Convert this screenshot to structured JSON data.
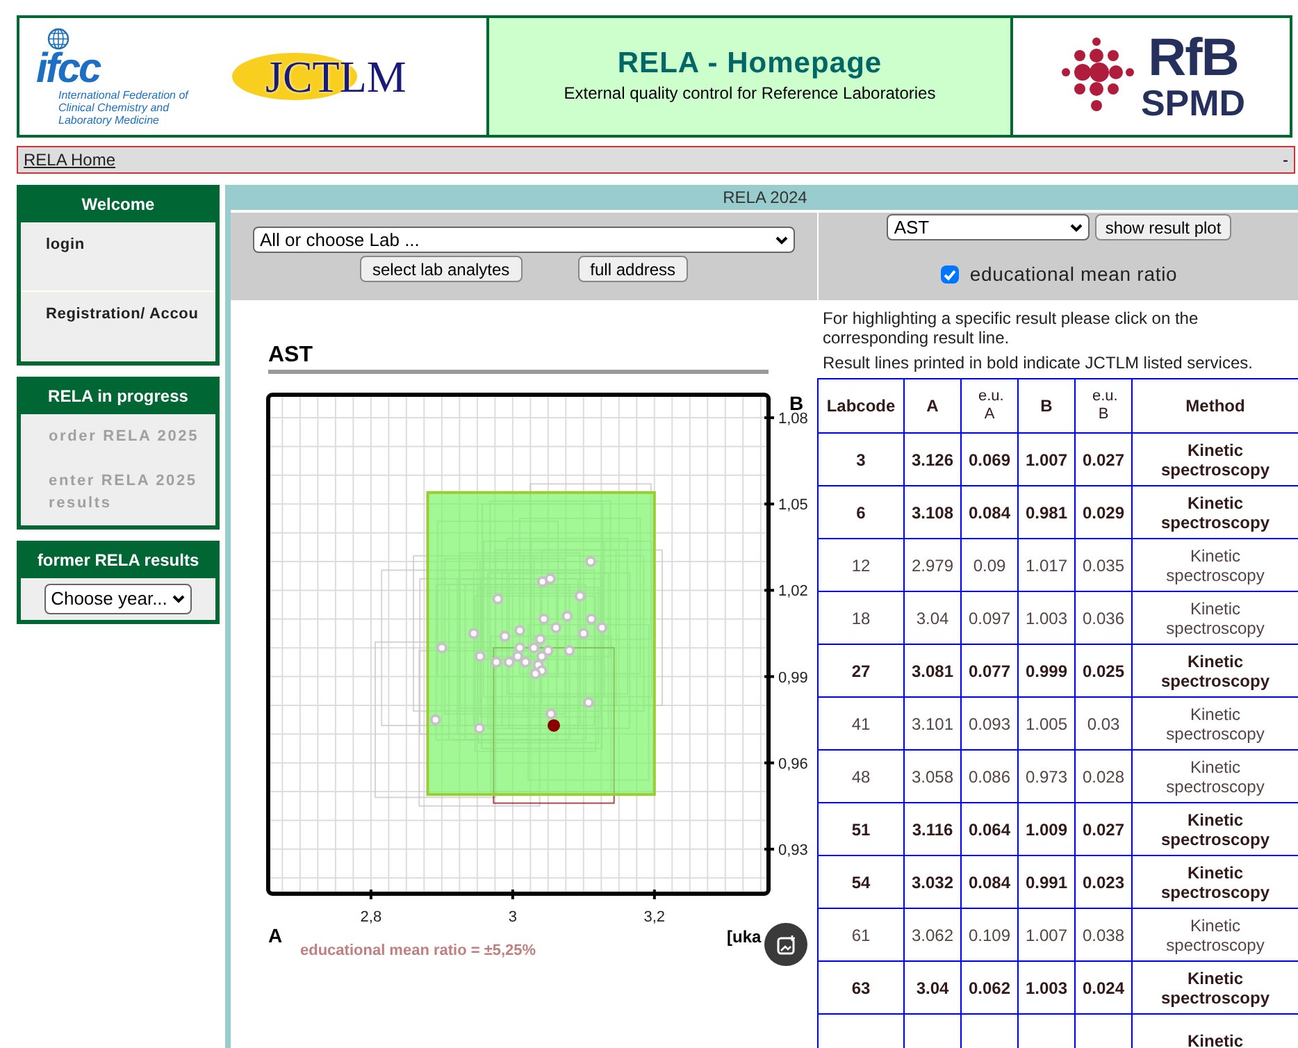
{
  "header": {
    "ifcc_logo": {
      "mark": "ifcc",
      "caption": "International Federation of Clinical Chemistry and Laboratory Medicine"
    },
    "jctlm_logo": "JCTLM",
    "title": "RELA - Homepage",
    "subtitle": "External quality control for Reference Laboratories",
    "rfb_logo": {
      "line1": "RfB",
      "line2": "SPMD"
    }
  },
  "breadcrumb": {
    "link": "RELA Home",
    "marker": "-"
  },
  "sidebar": [
    {
      "title": "Welcome",
      "items": [
        {
          "label": "login",
          "disabled": false
        },
        {
          "label": "Registration/ Accou",
          "disabled": false
        }
      ]
    },
    {
      "title": "RELA in progress",
      "items": [
        {
          "label": "order RELA 2025",
          "disabled": true
        },
        {
          "label": "enter RELA 2025 results",
          "disabled": true
        }
      ]
    },
    {
      "title": "former RELA results",
      "select": "Choose year..."
    }
  ],
  "main": {
    "title": "RELA 2024",
    "lab_select": "All or choose Lab ...",
    "buttons": [
      "select lab analytes",
      "full address"
    ],
    "analyte_select": "AST",
    "plot_button": "show result plot",
    "edu_checkbox": {
      "label": "educational mean ratio",
      "checked": true
    },
    "chart_title": "AST",
    "chart_data": {
      "type": "scatter",
      "grid": true,
      "xlabel": "A",
      "ylabel": "B",
      "xlim": [
        2.655,
        3.361
      ],
      "ylim": [
        0.9145,
        1.088
      ],
      "xticks": [
        {
          "value": 2.8,
          "label": "2,8"
        },
        {
          "value": 3,
          "label": "3"
        },
        {
          "value": 3.2,
          "label": "3,2"
        }
      ],
      "yticks": [
        {
          "value": 1.08,
          "label": "1,08"
        },
        {
          "value": 1.05,
          "label": "1,05"
        },
        {
          "value": 1.02,
          "label": "1,02"
        },
        {
          "value": 0.99,
          "label": "0,99"
        },
        {
          "value": 0.96,
          "label": "0,96"
        },
        {
          "value": 0.93,
          "label": "0,93"
        }
      ],
      "series": [
        {
          "color": "#c8c0c8",
          "x": [
            3.11,
            3.042,
            3.053,
            2.979,
            3.095,
            3.044,
            3.077,
            3.111,
            3.061,
            3.126,
            3.01,
            2.945,
            2.989,
            3.039,
            3.1,
            2.9,
            3.01,
            3.03,
            3.05,
            3.08,
            2.954,
            3.007,
            3.041,
            2.977,
            2.995,
            3.018,
            3.036,
            3.041,
            3.032,
            3.107,
            3.054,
            2.891,
            2.953
          ],
          "values": [
            1.03,
            1.023,
            1.024,
            1.017,
            1.018,
            1.01,
            1.011,
            1.01,
            1.007,
            1.007,
            1.006,
            1.005,
            1.004,
            1.003,
            1.005,
            1,
            1,
            1,
            0.999,
            0.999,
            0.997,
            0.997,
            0.997,
            0.995,
            0.995,
            0.995,
            0.994,
            0.992,
            0.991,
            0.981,
            0.977,
            0.975,
            0.972
          ]
        },
        {
          "color": "#8b0000",
          "x": [
            3.058
          ],
          "values": [
            0.973
          ]
        }
      ]
    },
    "unit": "[uka",
    "edu_note": "educational mean ratio = ±5,25%",
    "info": [
      "For highlighting a specific result please click on the corresponding result line.",
      "Result lines printed in bold indicate JCTLM listed services."
    ],
    "table": {
      "columns": [
        "Labcode",
        "A",
        "e.u. A",
        "B",
        "e.u. B",
        "Method"
      ],
      "rows": [
        {
          "cells": [
            "3",
            "3.126",
            "0.069",
            "1.007",
            "0.027",
            "Kinetic spectroscopy"
          ],
          "jctlm": true
        },
        {
          "cells": [
            "6",
            "3.108",
            "0.084",
            "0.981",
            "0.029",
            "Kinetic spectroscopy"
          ],
          "jctlm": true
        },
        {
          "cells": [
            "12",
            "2.979",
            "0.09",
            "1.017",
            "0.035",
            "Kinetic spectroscopy"
          ],
          "jctlm": false
        },
        {
          "cells": [
            "18",
            "3.04",
            "0.097",
            "1.003",
            "0.036",
            "Kinetic spectroscopy"
          ],
          "jctlm": false
        },
        {
          "cells": [
            "27",
            "3.081",
            "0.077",
            "0.999",
            "0.025",
            "Kinetic spectroscopy"
          ],
          "jctlm": true
        },
        {
          "cells": [
            "41",
            "3.101",
            "0.093",
            "1.005",
            "0.03",
            "Kinetic spectroscopy"
          ],
          "jctlm": false
        },
        {
          "cells": [
            "48",
            "3.058",
            "0.086",
            "0.973",
            "0.028",
            "Kinetic spectroscopy"
          ],
          "jctlm": false
        },
        {
          "cells": [
            "51",
            "3.116",
            "0.064",
            "1.009",
            "0.027",
            "Kinetic spectroscopy"
          ],
          "jctlm": true
        },
        {
          "cells": [
            "54",
            "3.032",
            "0.084",
            "0.991",
            "0.023",
            "Kinetic spectroscopy"
          ],
          "jctlm": true
        },
        {
          "cells": [
            "61",
            "3.062",
            "0.109",
            "1.007",
            "0.038",
            "Kinetic spectroscopy"
          ],
          "jctlm": false
        },
        {
          "cells": [
            "63",
            "3.04",
            "0.062",
            "1.003",
            "0.024",
            "Kinetic spectroscopy"
          ],
          "jctlm": true
        },
        {
          "cells": [
            "",
            "",
            "",
            "",
            "",
            "Kinetic"
          ],
          "jctlm": true
        }
      ]
    }
  }
}
